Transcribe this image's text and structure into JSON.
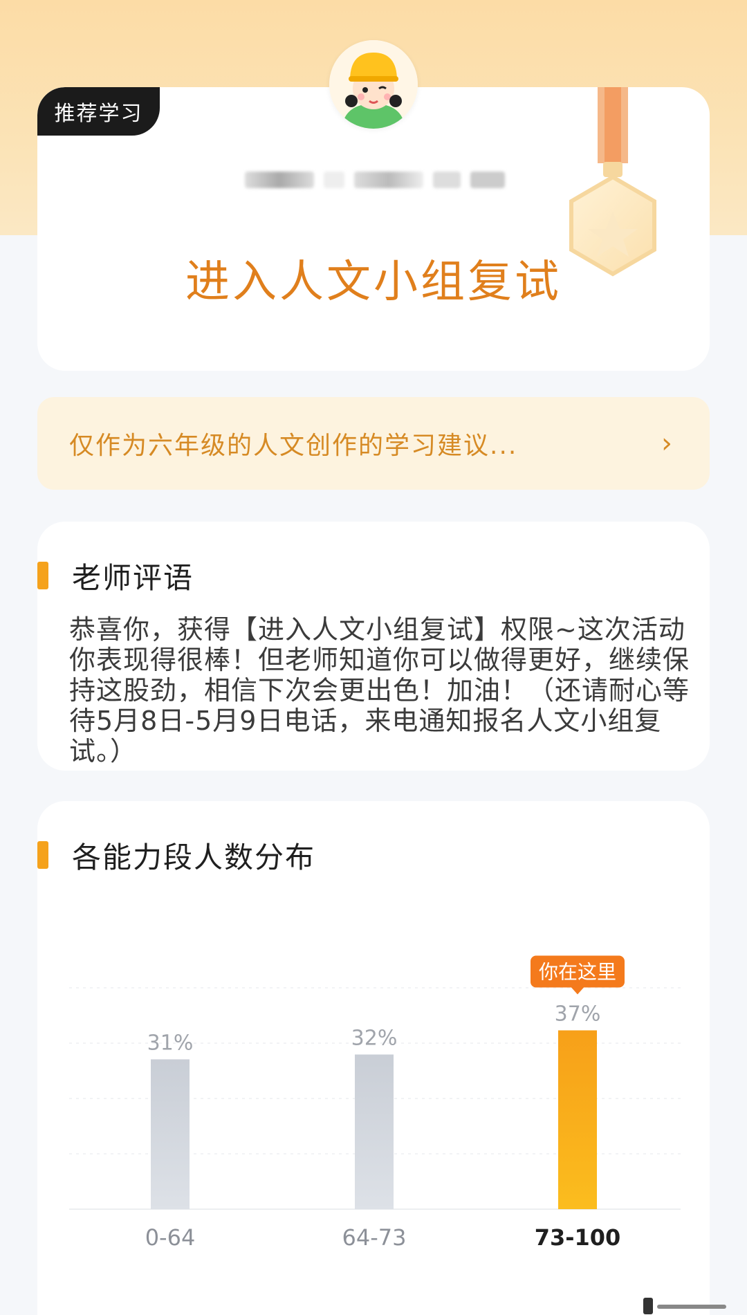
{
  "hero": {
    "tag": "推荐学习",
    "title": "进入人文小组复试"
  },
  "advice": {
    "text": "仅作为六年级的人文创作的学习建议...",
    "arrow": "›"
  },
  "comment": {
    "title": "老师评语",
    "body": "恭喜你，获得【进入人文小组复试】权限~这次活动你表现得很棒！但老师知道你可以做得更好，继续保持这股劲，相信下次会更出色！加油！（还请耐心等待5月8日-5月9日电话，来电通知报名人文小组复试。）"
  },
  "distribution": {
    "title": "各能力段人数分布",
    "you_are_here": "你在这里"
  },
  "colors": {
    "accent": "#f5a21c",
    "title_orange": "#e07f1c",
    "bar_gray": "#cfd5de",
    "bar_highlight": "#f8a51c"
  },
  "chart_data": {
    "type": "bar",
    "title": "各能力段人数分布",
    "categories": [
      "0-64",
      "64-73",
      "73-100"
    ],
    "values": [
      31,
      32,
      37
    ],
    "value_labels": [
      "31%",
      "32%",
      "37%"
    ],
    "unit": "%",
    "highlight_index": 2,
    "grid": true
  }
}
